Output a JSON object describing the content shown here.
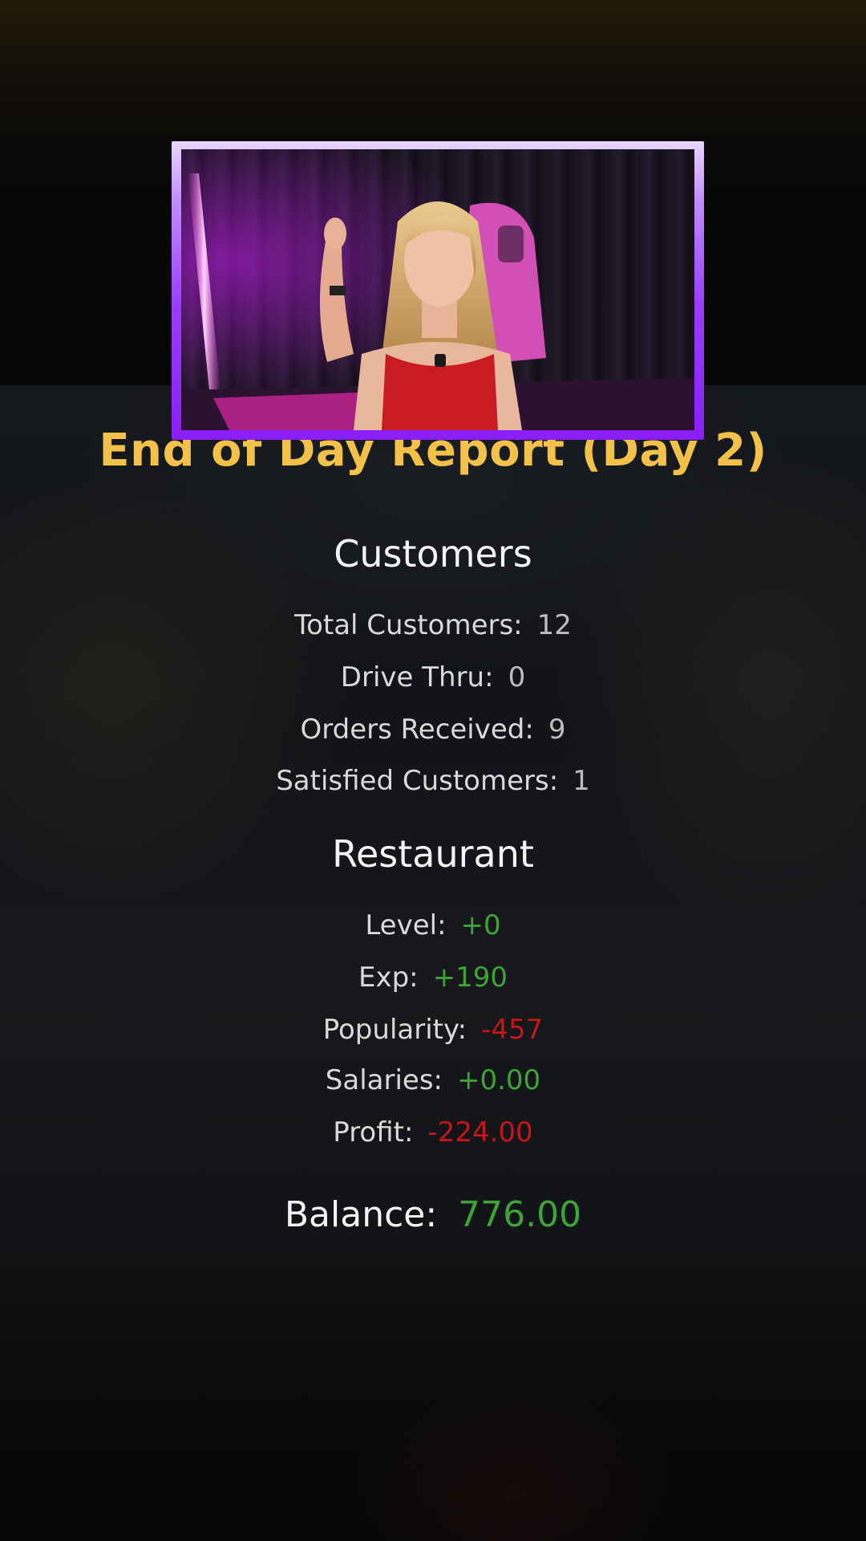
{
  "report": {
    "title": "End of Day Report (Day 2)"
  },
  "customers": {
    "heading": "Customers",
    "stats": [
      {
        "label": "Total Customers:",
        "value": "12"
      },
      {
        "label": "Drive Thru:",
        "value": "0"
      },
      {
        "label": "Orders Received:",
        "value": "9"
      },
      {
        "label": "Satisfied Customers:",
        "value": "1"
      }
    ]
  },
  "restaurant": {
    "heading": "Restaurant",
    "stats": [
      {
        "label": "Level:",
        "value": "+0",
        "tone": "positive"
      },
      {
        "label": "Exp:",
        "value": "+190",
        "tone": "positive"
      },
      {
        "label": "Popularity:",
        "value": "-457",
        "tone": "negative"
      },
      {
        "label": "Salaries:",
        "value": "+0.00",
        "tone": "positive"
      },
      {
        "label": "Profit:",
        "value": "-224.00",
        "tone": "negative"
      }
    ]
  },
  "balance": {
    "label": "Balance:",
    "value": "776.00"
  },
  "colors": {
    "title": "#f2c14a",
    "positive": "#3fa437",
    "negative": "#c4161c",
    "neutral": "#bdbdbd",
    "webcam_border": "#9a3dff"
  }
}
